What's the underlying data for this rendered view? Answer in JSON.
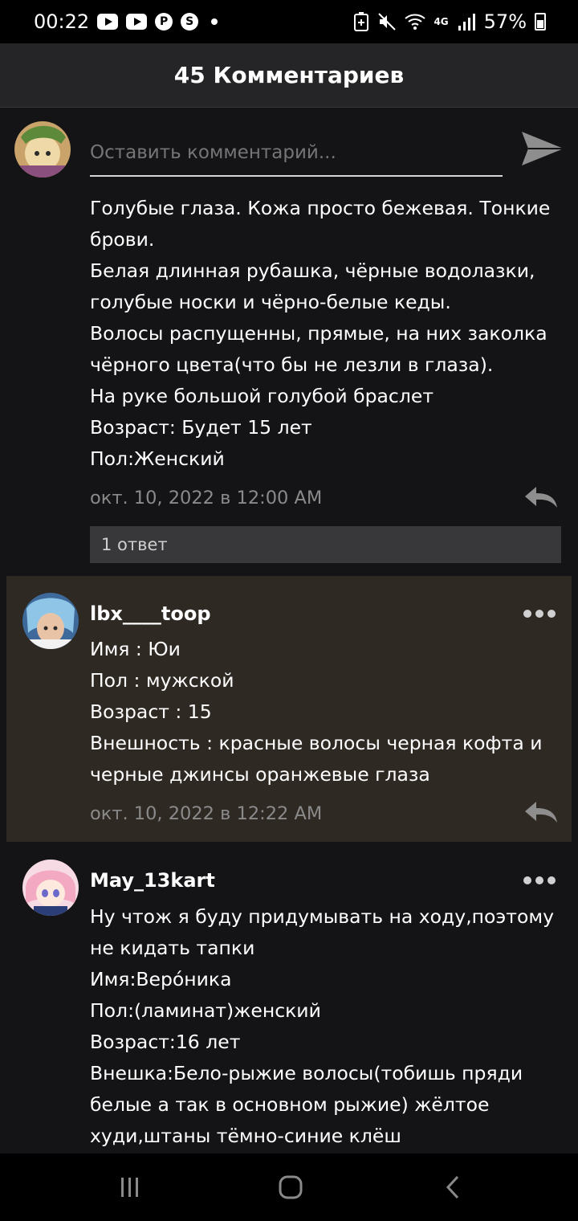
{
  "status_bar": {
    "time": "00:22",
    "battery": "57%",
    "network": "4G",
    "icons": [
      "youtube-icon",
      "youtube-icon",
      "pinterest-icon",
      "app-icon",
      "dot-icon"
    ]
  },
  "header": {
    "title": "45 Комментариев"
  },
  "comment_input": {
    "placeholder": "Оставить комментарий..."
  },
  "comments": [
    {
      "lines": [
        "Голубые глаза. Кожа просто бежевая. Тонкие",
        "брови.",
        "Белая длинная рубашка, чёрные водолазки,",
        "голубые носки и чёрно-белые кеды.",
        "Волосы распущенны, прямые, на них заколка",
        "чёрного цвета(что бы не лезли в глаза).",
        "На руке большой голубой браслет",
        "Возраст: Будет 15 лет",
        "Пол:Женский"
      ],
      "timestamp": "окт. 10, 2022 в 12:00 AM",
      "replies_label": "1 ответ"
    },
    {
      "username": "lbx____toop",
      "lines": [
        "Имя : Юи",
        "Пол : мужской",
        "Возраст : 15",
        "Внешность : красные волосы черная кофта и",
        "черные джинсы оранжевые глаза"
      ],
      "timestamp": "окт. 10, 2022 в 12:22 AM"
    },
    {
      "username": "May_13kart",
      "lines": [
        "Ну чтож я буду придумывать на ходу,поэтому",
        "не кидать тапки",
        "Имя:Веро́ника",
        "Пол:(ламинат)женский",
        "Возраст:16 лет",
        "Внешка:Бело-рыжие волосы(тобишь пряди",
        "белые а так в основном рыжие) жёлтое",
        "худи,штаны тёмно-синие клёш"
      ]
    }
  ],
  "colors": {
    "background": "#141416",
    "header": "#252527",
    "highlight": "#2f2924",
    "replies_bar": "#38383a"
  }
}
